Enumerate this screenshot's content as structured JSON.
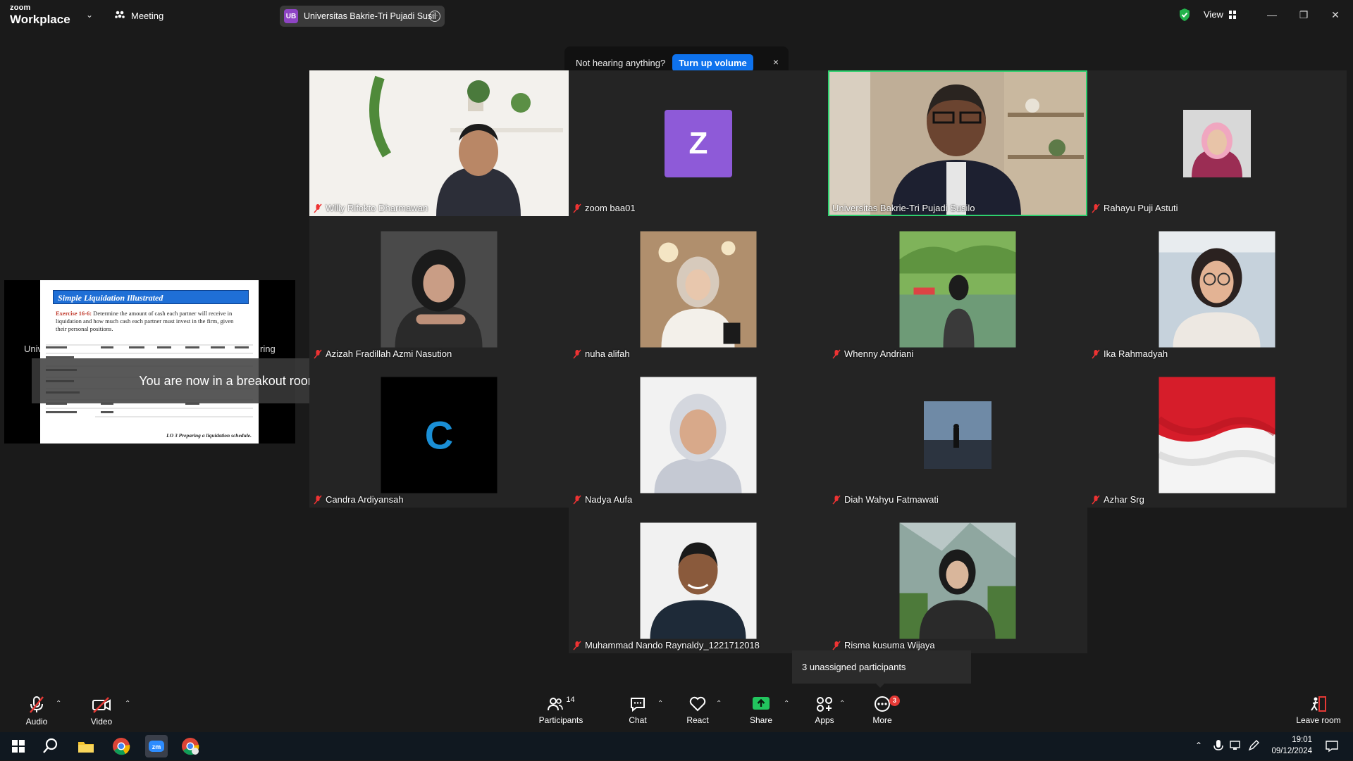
{
  "titlebar": {
    "brand_line1": "zoom",
    "brand_line2": "Workplace",
    "meeting_label": "Meeting",
    "session_initials": "UB",
    "session_name": "Universitas Bakrie-Tri Pujadi Susil",
    "view_label": "View"
  },
  "tip": {
    "text": "Not hearing anything?",
    "button": "Turn up volume",
    "close": "×"
  },
  "participants": [
    {
      "name": "Willy Rifokto Dharmawan",
      "muted": true,
      "kind": "video"
    },
    {
      "name": "zoom baa01",
      "muted": true,
      "kind": "letter",
      "letter": "Z"
    },
    {
      "name": "Universitas Bakrie-Tri Pujadi Susilo",
      "muted": false,
      "kind": "video",
      "active": true
    },
    {
      "name": "Rahayu Puji Astuti",
      "muted": true,
      "kind": "photo"
    },
    {
      "name": "Azizah Fradillah Azmi Nasution",
      "muted": true,
      "kind": "photo"
    },
    {
      "name": "nuha alifah",
      "muted": true,
      "kind": "photo"
    },
    {
      "name": "Whenny Andriani",
      "muted": true,
      "kind": "photo"
    },
    {
      "name": "Ika Rahmadyah",
      "muted": true,
      "kind": "photo"
    },
    {
      "name": "Candra Ardiyansah",
      "muted": true,
      "kind": "letter",
      "letter": "C"
    },
    {
      "name": "Nadya Aufa",
      "muted": true,
      "kind": "photo"
    },
    {
      "name": "Diah Wahyu Fatmawati",
      "muted": true,
      "kind": "photo"
    },
    {
      "name": "Azhar Srg",
      "muted": true,
      "kind": "photo"
    },
    {
      "name": "Muhammad Nando Raynaldy_1221712018",
      "muted": true,
      "kind": "photo"
    },
    {
      "name": "Risma kusuma Wijaya",
      "muted": true,
      "kind": "photo"
    }
  ],
  "slide": {
    "title": "Simple Liquidation Illustrated",
    "exercise_label": "Exercise 16-6:",
    "exercise_text": "Determine the amount of cash each partner will receive in liquidation and how much cash each partner must invest in the firm, given their personal positions.",
    "footer": "LO 3  Preparing a liquidation schedule.",
    "side_left": "Univ",
    "side_right": "ring"
  },
  "breakout_message": "You are now in a breakout room",
  "unassigned_message": "3 unassigned participants",
  "toolbar": {
    "audio": "Audio",
    "video": "Video",
    "participants": "Participants",
    "participants_count": "14",
    "chat": "Chat",
    "react": "React",
    "share": "Share",
    "apps": "Apps",
    "more": "More",
    "more_badge": "3",
    "leave": "Leave room"
  },
  "taskbar": {
    "time": "19:01",
    "date": "09/12/2024"
  },
  "colors": {
    "accent": "#0e72ed",
    "active_speaker": "#2ed06e",
    "share_green": "#22c55e",
    "letter_z_bg": "#8e5ad8",
    "letter_c_fg": "#1a8fd6"
  }
}
